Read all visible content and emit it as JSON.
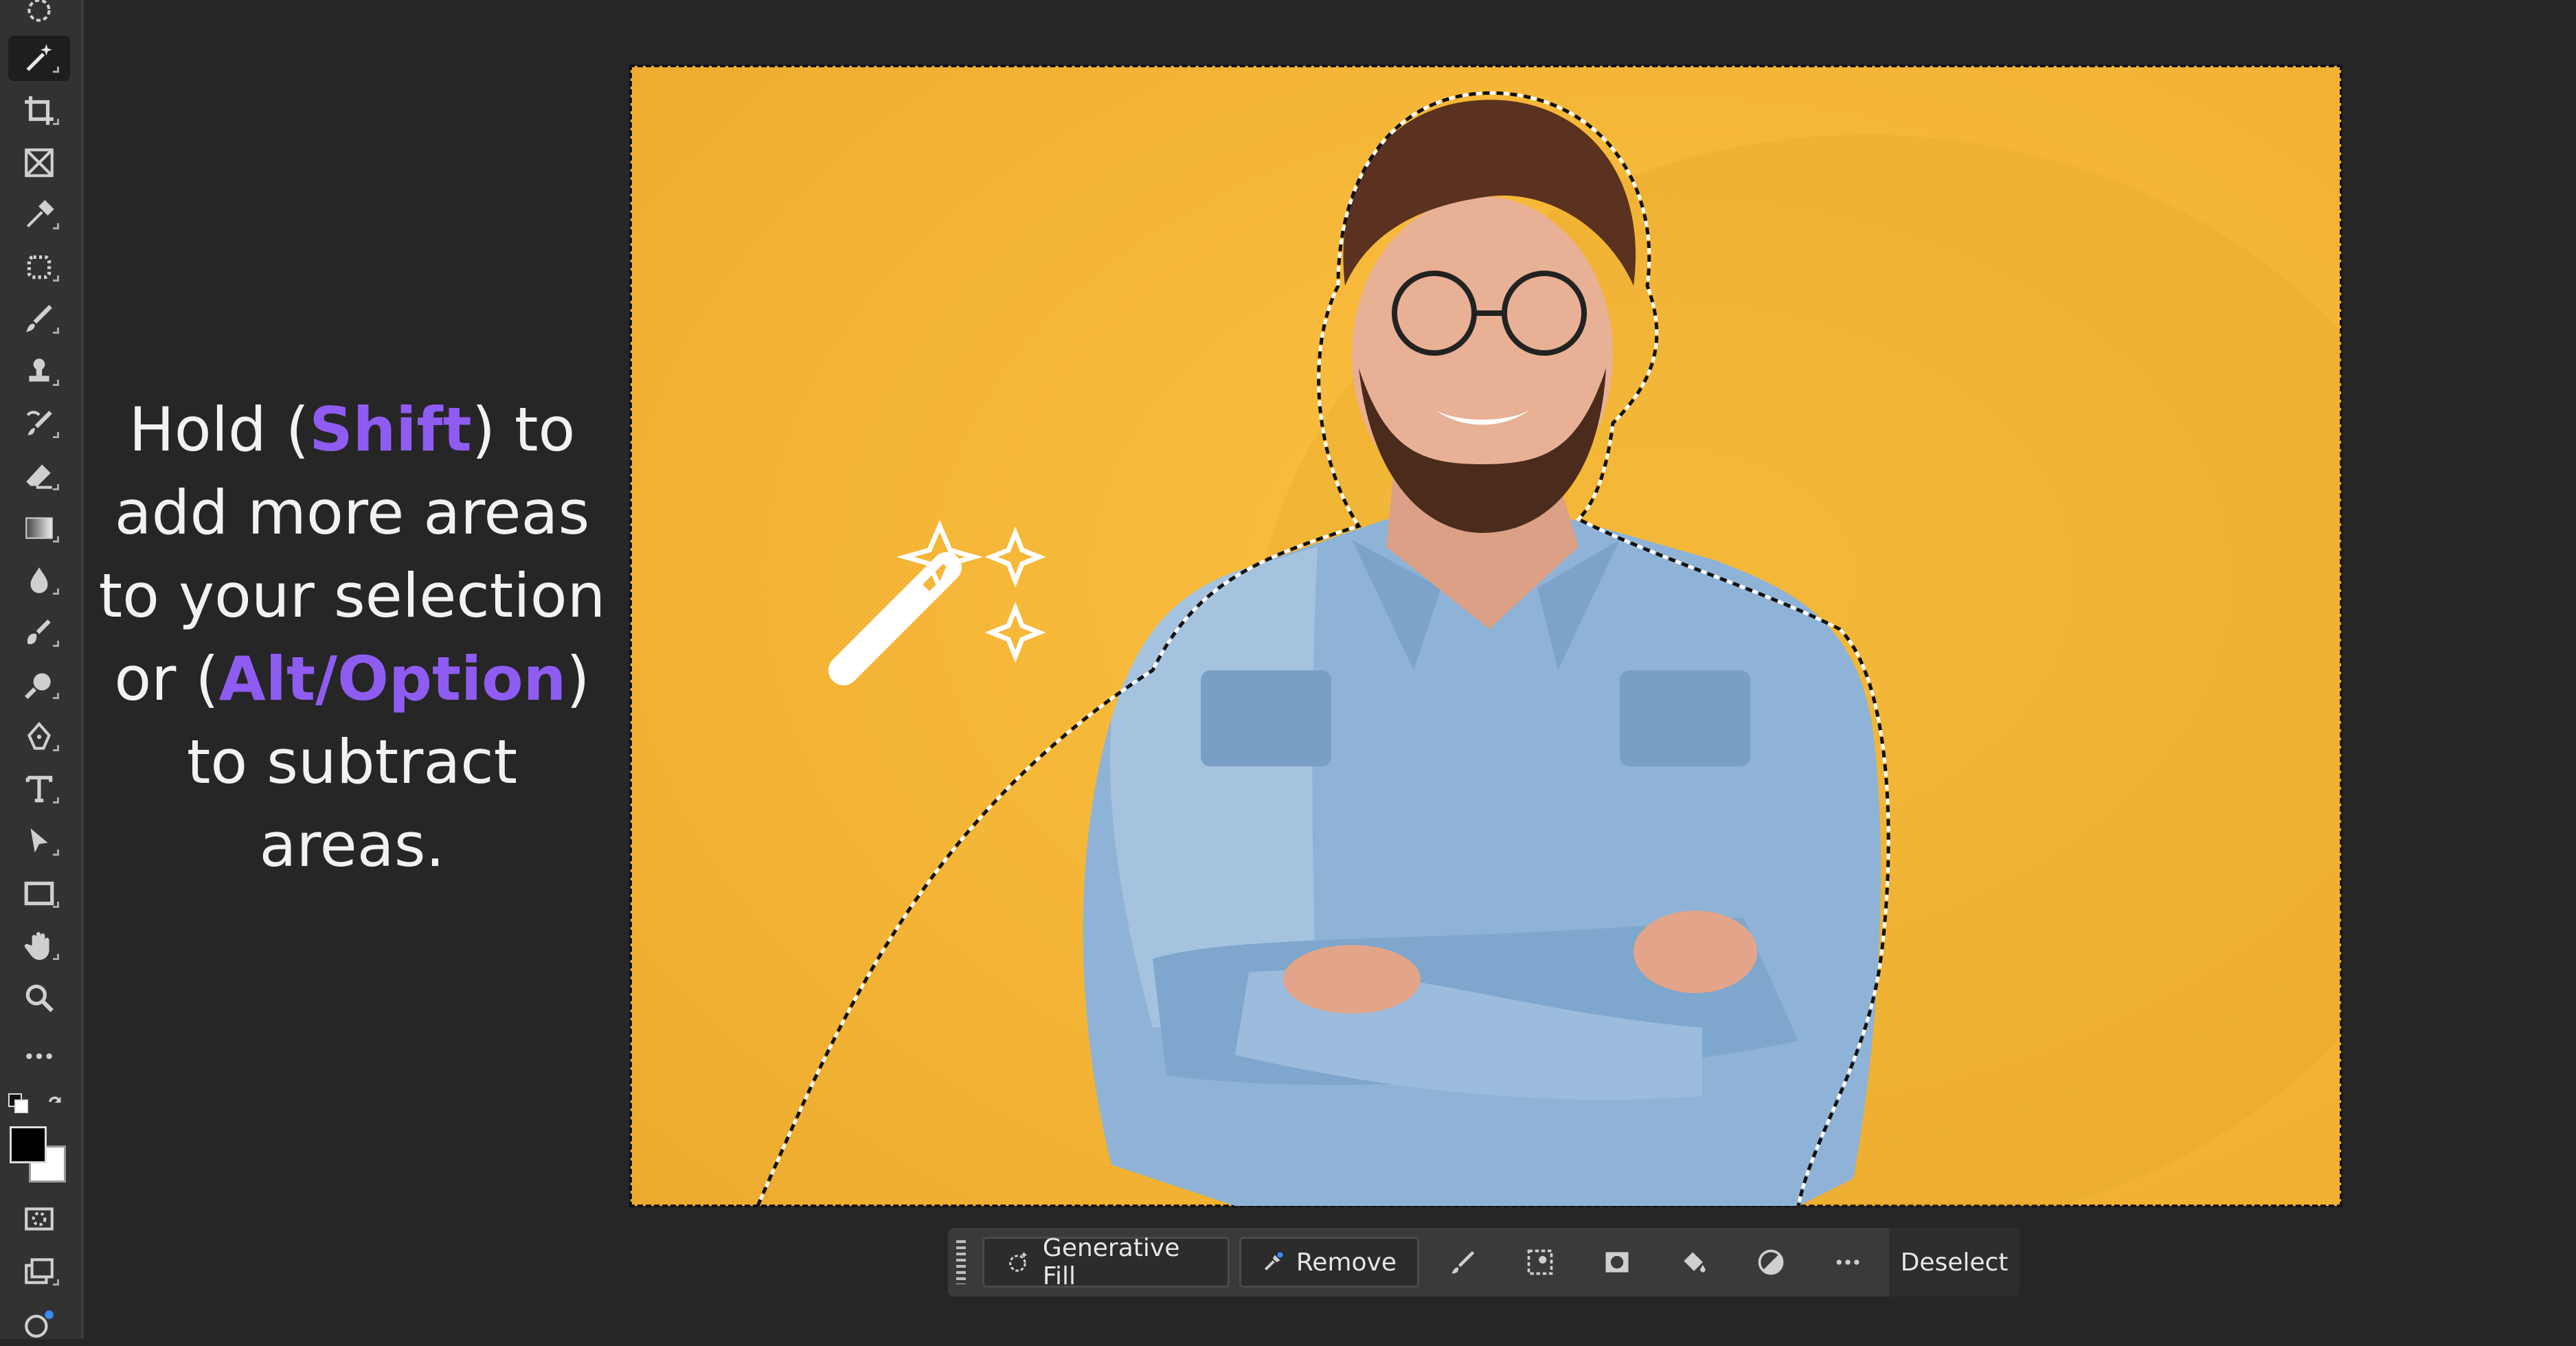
{
  "instruction": {
    "hold": "Hold (",
    "shift_key": "Shift",
    "to_add": ") to add more areas to your selection or (",
    "alt_key": "Alt/Option",
    "to_subtract": ") to subtract areas."
  },
  "toolbar": {
    "tools": [
      "object-selection-icon",
      "magic-wand-icon",
      "crop-icon",
      "frame-icon",
      "eyedropper-icon",
      "healing-brush-icon",
      "brush-icon",
      "clone-stamp-icon",
      "history-brush-icon",
      "eraser-icon",
      "gradient-icon",
      "blur-icon",
      "dodge-icon",
      "pen-icon",
      "type-icon",
      "path-selection-icon",
      "rectangle-icon",
      "hand-icon",
      "zoom-icon",
      "more-tools-icon"
    ],
    "active_tool": "magic-wand-icon",
    "foreground_color": "#000000",
    "background_color": "#ffffff"
  },
  "taskbar": {
    "generative_fill_label": "Generative Fill",
    "remove_label": "Remove",
    "deselect_label": "Deselect"
  },
  "colors": {
    "accent": "#8f5cf2",
    "canvas_background": "#f7b739",
    "shirt": "#e95a5a",
    "denim": "#8fb3d6"
  }
}
